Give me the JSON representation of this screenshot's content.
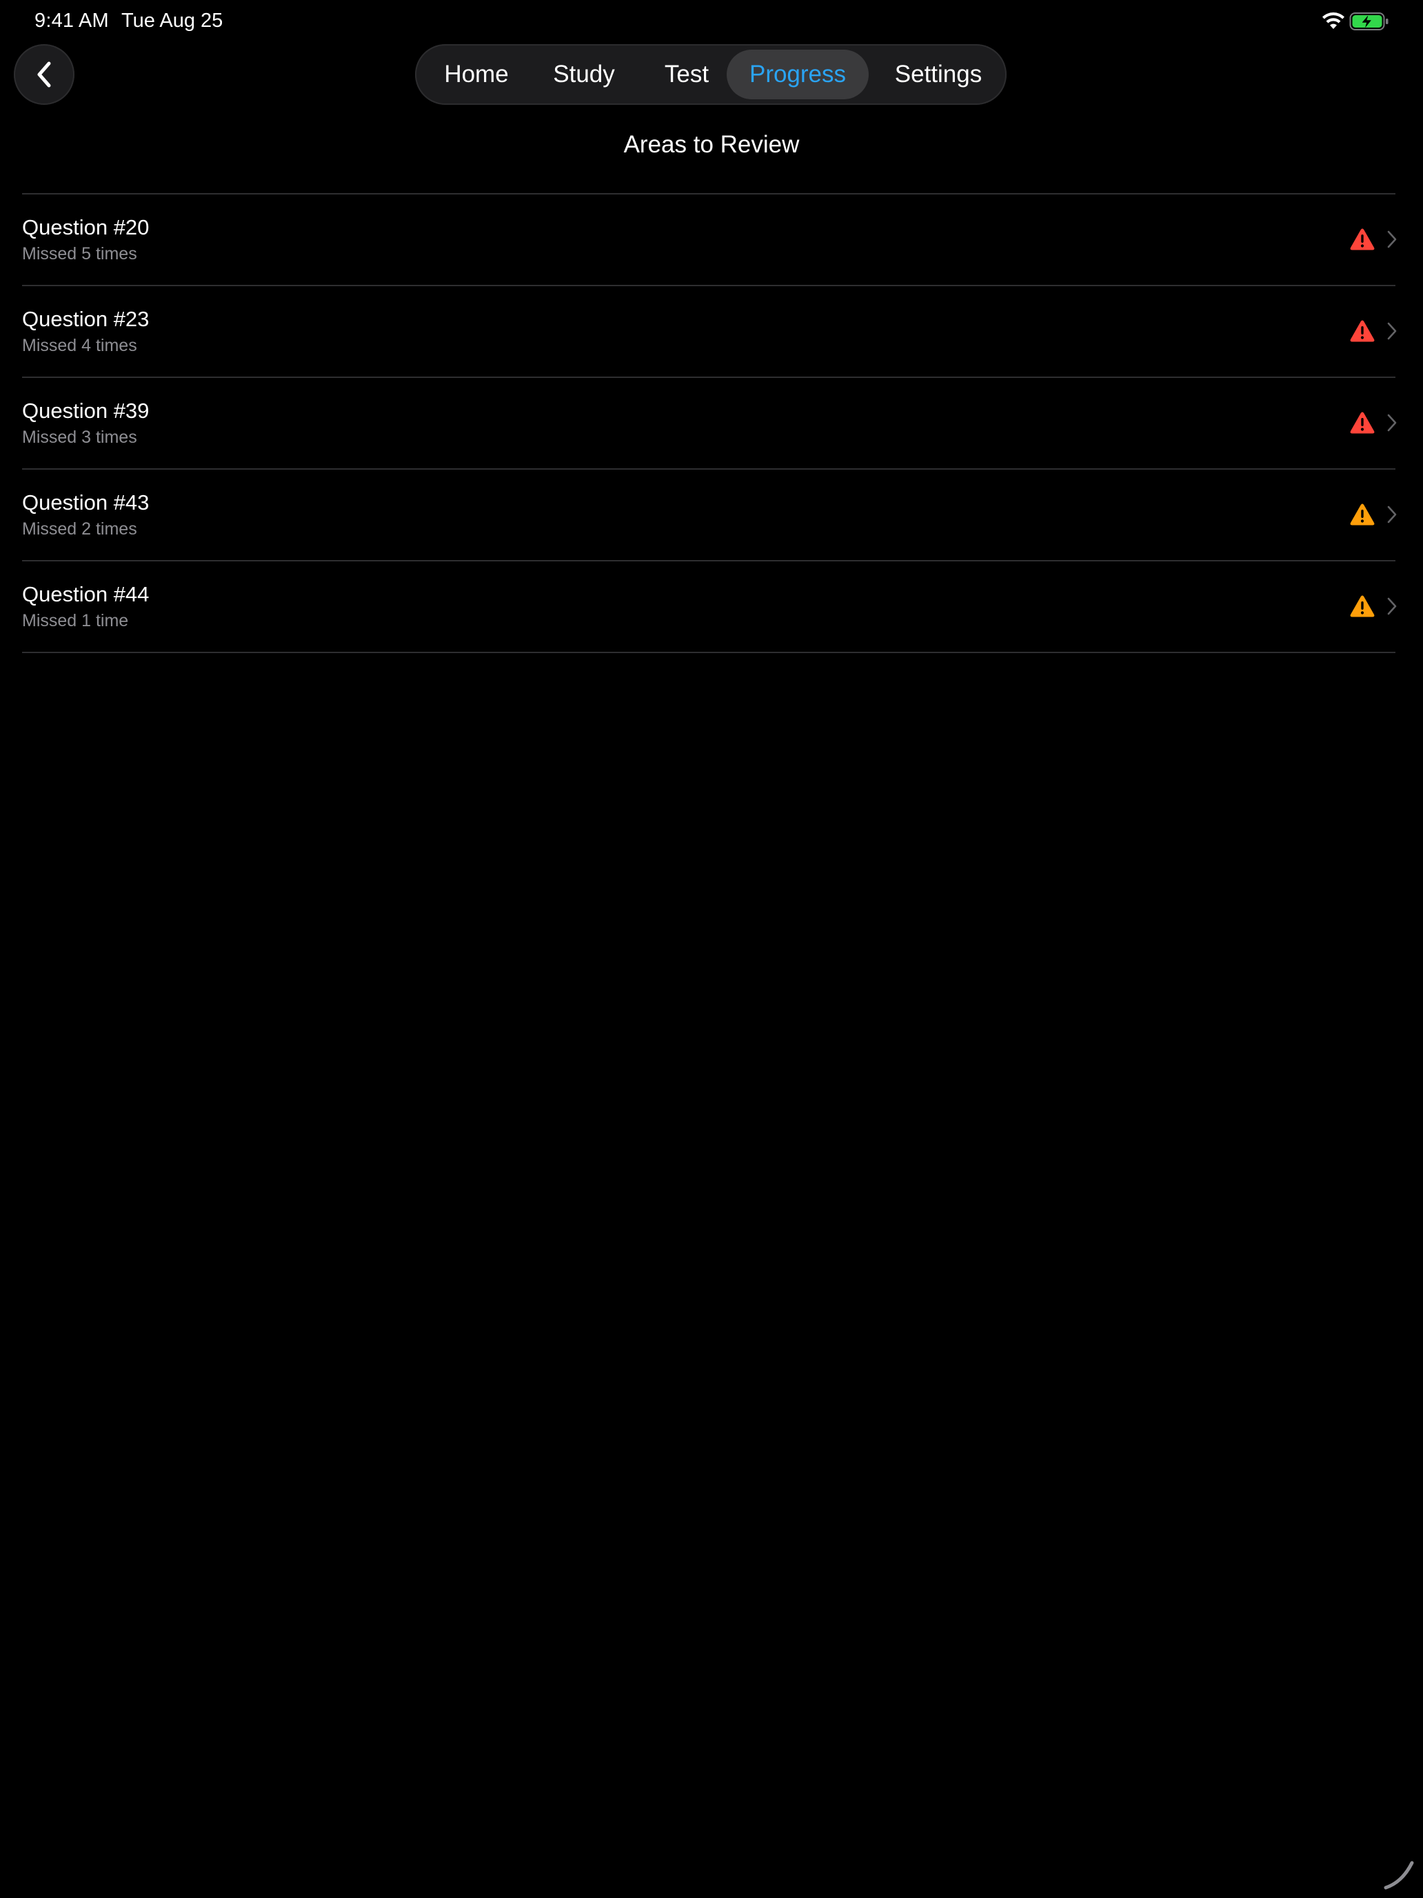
{
  "status_bar": {
    "time": "9:41 AM",
    "date": "Tue Aug 25"
  },
  "nav": {
    "tabs": [
      {
        "label": "Home",
        "active": false
      },
      {
        "label": "Study",
        "active": false
      },
      {
        "label": "Test",
        "active": false
      },
      {
        "label": "Progress",
        "active": true
      },
      {
        "label": "Settings",
        "active": false
      }
    ],
    "active_color": "#2aa4f4"
  },
  "page": {
    "title": "Areas to Review"
  },
  "review_items": [
    {
      "title": "Question #20",
      "subtitle": "Missed 5 times",
      "severity": "high",
      "icon": "warning-icon",
      "color": "#ff453a"
    },
    {
      "title": "Question #23",
      "subtitle": "Missed 4 times",
      "severity": "high",
      "icon": "warning-icon",
      "color": "#ff453a"
    },
    {
      "title": "Question #39",
      "subtitle": "Missed 3 times",
      "severity": "high",
      "icon": "warning-icon",
      "color": "#ff453a"
    },
    {
      "title": "Question #43",
      "subtitle": "Missed 2 times",
      "severity": "medium",
      "icon": "warning-icon",
      "color": "#ff9f0a"
    },
    {
      "title": "Question #44",
      "subtitle": "Missed 1 time",
      "severity": "medium",
      "icon": "warning-icon",
      "color": "#ff9f0a"
    }
  ]
}
